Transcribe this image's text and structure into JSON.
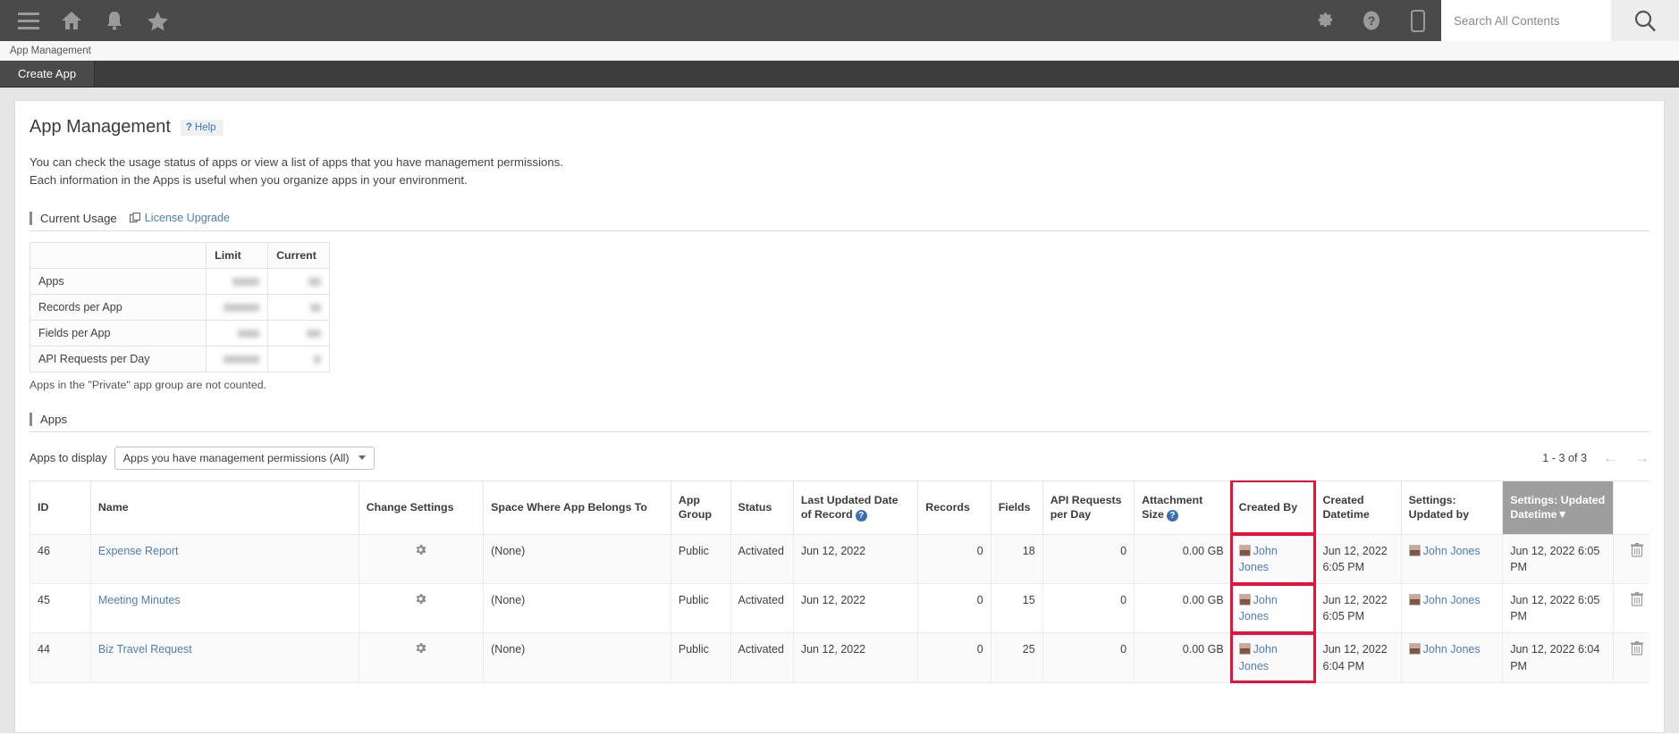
{
  "topbar": {
    "icons_left": [
      "menu-icon",
      "home-icon",
      "bell-icon",
      "star-icon"
    ],
    "icons_right": [
      "gear-icon",
      "help-icon",
      "mobile-icon"
    ],
    "search_placeholder": "Search All Contents",
    "search_value": "",
    "bg": "#4a4a4a"
  },
  "breadcrumb": {
    "text": "App Management"
  },
  "actionbar": {
    "create_app_label": "Create App"
  },
  "page": {
    "title": "App Management",
    "help_label": "Help",
    "help_mark": "?",
    "description_line1": "You can check the usage status of apps or view a list of apps that you have management permissions.",
    "description_line2": "Each information in the Apps is useful when you organize apps in your environment."
  },
  "current_usage": {
    "section_title": "Current Usage",
    "license_link": "License Upgrade",
    "columns": [
      "",
      "Limit",
      "Current"
    ],
    "rows": [
      {
        "label": "Apps",
        "limit": "",
        "current": "",
        "redacted": true,
        "limit_w": 30,
        "cur_w": 14
      },
      {
        "label": "Records per App",
        "limit": "",
        "current": "",
        "redacted": true,
        "limit_w": 40,
        "cur_w": 12
      },
      {
        "label": "Fields per App",
        "limit": "",
        "current": "",
        "redacted": true,
        "limit_w": 24,
        "cur_w": 16
      },
      {
        "label": "API Requests per Day",
        "limit": "",
        "current": "",
        "redacted": true,
        "limit_w": 40,
        "cur_w": 8
      }
    ],
    "note": "Apps in the \"Private\" app group are not counted."
  },
  "apps": {
    "section_title": "Apps",
    "apps_to_display_label": "Apps to display",
    "filter_selected": "Apps you have management permissions (All)",
    "pager_text": "1 - 3 of 3",
    "pager_prev": "←",
    "pager_next": "→",
    "columns": [
      {
        "label": "ID"
      },
      {
        "label": "Name"
      },
      {
        "label": "Change Settings"
      },
      {
        "label": "Space Where App Belongs To"
      },
      {
        "label": "App Group"
      },
      {
        "label": "Status"
      },
      {
        "label": "Last Updated Date of Record",
        "help": true
      },
      {
        "label": "Records"
      },
      {
        "label": "Fields"
      },
      {
        "label": "API Requests per Day"
      },
      {
        "label": "Attachment Size",
        "help": true
      },
      {
        "label": "Created By",
        "highlight": true
      },
      {
        "label": "Created Datetime"
      },
      {
        "label": "Settings: Updated by"
      },
      {
        "label": "Settings: Updated Datetime",
        "sorted": true,
        "sort_arrow": "▼"
      },
      {
        "label": ""
      }
    ],
    "rows": [
      {
        "id": "46",
        "name": "Expense Report",
        "space": "(None)",
        "group": "Public",
        "status": "Activated",
        "last_updated": "Jun 12, 2022",
        "records": "0",
        "fields": "18",
        "api_requests": "0",
        "attachment_size": "0.00 GB",
        "created_by": "John Jones",
        "created_datetime": "Jun 12, 2022 6:05 PM",
        "settings_updated_by": "John Jones",
        "settings_updated_datetime": "Jun 12, 2022 6:05 PM"
      },
      {
        "id": "45",
        "name": "Meeting Minutes",
        "space": "(None)",
        "group": "Public",
        "status": "Activated",
        "last_updated": "Jun 12, 2022",
        "records": "0",
        "fields": "15",
        "api_requests": "0",
        "attachment_size": "0.00 GB",
        "created_by": "John Jones",
        "created_datetime": "Jun 12, 2022 6:05 PM",
        "settings_updated_by": "John Jones",
        "settings_updated_datetime": "Jun 12, 2022 6:05 PM"
      },
      {
        "id": "44",
        "name": "Biz Travel Request",
        "space": "(None)",
        "group": "Public",
        "status": "Activated",
        "last_updated": "Jun 12, 2022",
        "records": "0",
        "fields": "25",
        "api_requests": "0",
        "attachment_size": "0.00 GB",
        "created_by": "John Jones",
        "created_datetime": "Jun 12, 2022 6:04 PM",
        "settings_updated_by": "John Jones",
        "settings_updated_datetime": "Jun 12, 2022 6:04 PM"
      }
    ]
  },
  "colors": {
    "link": "#4a7eb5",
    "highlight": "#e8113c",
    "topbar_bg": "#4a4a4a",
    "sorted_header_bg": "#9e9e9e"
  }
}
